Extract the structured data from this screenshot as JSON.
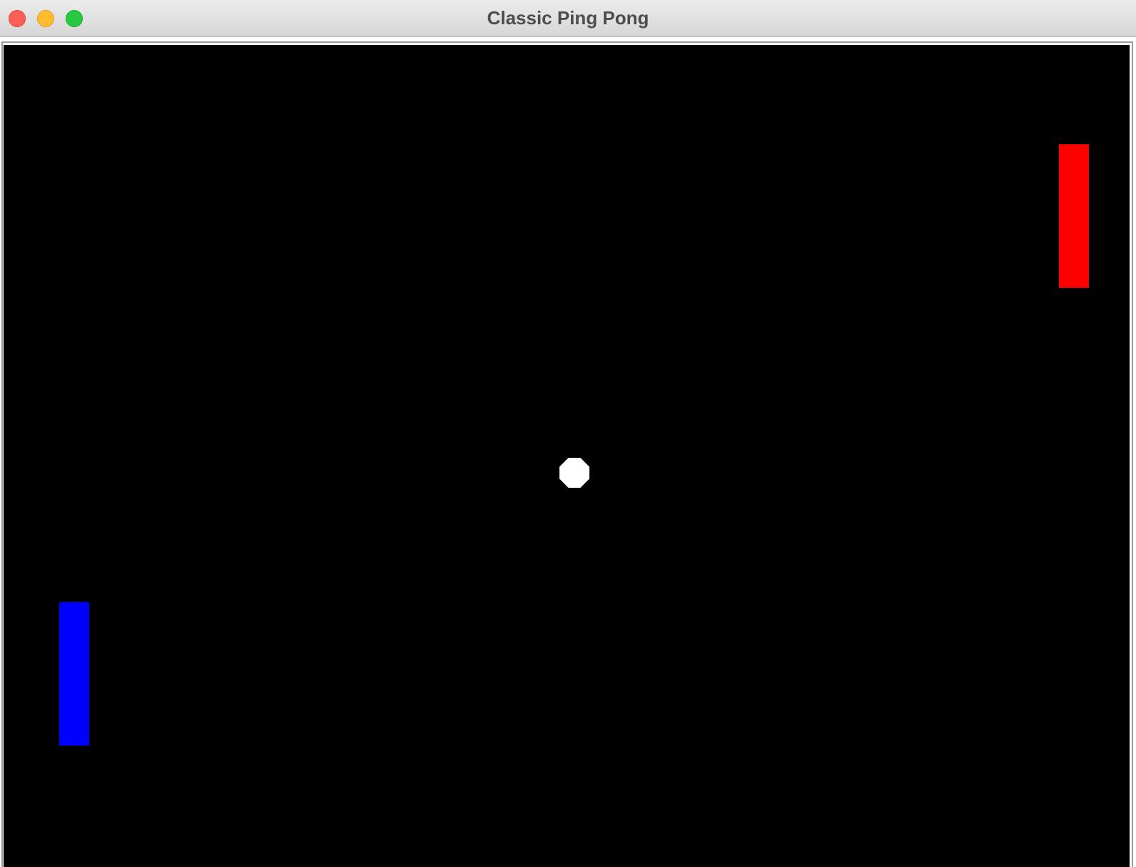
{
  "window": {
    "title": "Classic Ping Pong"
  },
  "controls": {
    "close_color": "#ff5f57",
    "minimize_color": "#febc2e",
    "zoom_color": "#28c840"
  },
  "game": {
    "background_color": "#000000",
    "ball_color": "#ffffff",
    "left_paddle_color": "#0000ff",
    "right_paddle_color": "#ff0000"
  }
}
